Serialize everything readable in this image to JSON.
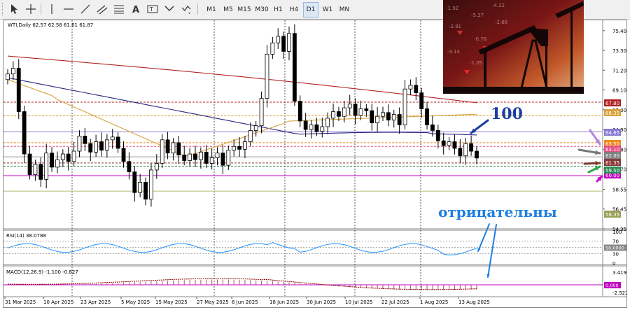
{
  "toolbar": {
    "timeframes": [
      "M1",
      "M5",
      "M15",
      "M30",
      "H1",
      "H4",
      "D1",
      "W1",
      "MN"
    ],
    "selected": "D1",
    "icons": [
      "cursor-icon",
      "crosshair-icon",
      "horizontal-line-icon",
      "trend-line-icon",
      "channel-icon",
      "fibonacci-icon",
      "text-icon",
      "label-icon",
      "shapes-icon"
    ]
  },
  "chart": {
    "header": "WTI,Daily  62.57 62.58 61.61 61.87",
    "price_ticks": [
      "75.40",
      "73.30",
      "71.20",
      "69.10",
      "67.00",
      "64.90",
      "62.80",
      "60.70",
      "58.55",
      "56.45",
      "54.35"
    ],
    "price_labels": [
      {
        "text": "67.80",
        "color": "#b22222"
      },
      {
        "text": "66.35",
        "color": "#d9a23a"
      },
      {
        "text": "64.65",
        "color": "#8a7bd6"
      },
      {
        "text": "63.50",
        "color": "#f08a1c"
      },
      {
        "text": "63.10",
        "color": "#e05080"
      },
      {
        "text": "62.00",
        "color": "#808080"
      },
      {
        "text": "61.35",
        "color": "#8b3a3a"
      },
      {
        "text": "60.00",
        "color": "#c000c0"
      },
      {
        "text": "59.50",
        "color": "#2e8b57"
      },
      {
        "text": "58.35",
        "color": "#9aa05a"
      }
    ],
    "annotation_100": "100",
    "annotation_word": "отрицательны"
  },
  "rsi": {
    "header": "RSI(14) 38.0788",
    "ticks": [
      "100",
      "70",
      "50.0000",
      "30",
      "0"
    ]
  },
  "macd": {
    "header": "MACD(12,26,9) -1.100 -0.827",
    "ticks": [
      "3.419",
      "0.000",
      "-2.522"
    ]
  },
  "dates": [
    "31 Mar 2025",
    "10 Apr 2025",
    "23 Apr 2025",
    "5 May 2025",
    "15 May 2025",
    "27 May 2025",
    "6 Jun 2025",
    "18 Jun 2025",
    "30 Jun 2025",
    "10 Jul 2025",
    "22 Jul 2025",
    "1 Aug 2025",
    "13 Aug 2025"
  ],
  "chart_data": {
    "type": "candlestick",
    "title": "WTI,Daily",
    "ohlc_last": {
      "open": 62.57,
      "high": 62.58,
      "low": 61.61,
      "close": 61.87
    },
    "closes": [
      70.8,
      71.4,
      66.8,
      62.3,
      60.1,
      61.2,
      59.6,
      62.4,
      60.9,
      61.7,
      62.3,
      61.5,
      62.6,
      64.2,
      63.4,
      62.5,
      63.6,
      62.7,
      63.8,
      64.1,
      62.9,
      61.5,
      60.4,
      58.2,
      59.3,
      57.5,
      60.6,
      61.3,
      63.8,
      62.4,
      63.5,
      62.2,
      61.6,
      62.3,
      61.7,
      62.5,
      61.3,
      61.9,
      62.4,
      61.1,
      62.7,
      63.1,
      62.8,
      63.6,
      64.8,
      65.3,
      68.2,
      72.9,
      74.1,
      74.8,
      73.2,
      75.1,
      67.9,
      65.8,
      64.9,
      65.4,
      64.7,
      65.2,
      66.1,
      66.8,
      66.3,
      67.2,
      67.6,
      66.4,
      67.1,
      66.9,
      65.6,
      66.3,
      66.7,
      65.9,
      66.5,
      65.4,
      69.2,
      69.6,
      68.8,
      67.1,
      65.4,
      64.8,
      63.7,
      63.2,
      63.6,
      62.9,
      62.1,
      63.4,
      62.6,
      61.87
    ],
    "moving_averages": [
      {
        "color": "#b22222"
      },
      {
        "color": "#2a2a80"
      },
      {
        "color": "#d9a23a"
      }
    ],
    "ylim": [
      54.35,
      76.5
    ],
    "rsi_last": 38.0788,
    "macd_last": {
      "macd": -1.1,
      "signal": -0.827
    }
  }
}
